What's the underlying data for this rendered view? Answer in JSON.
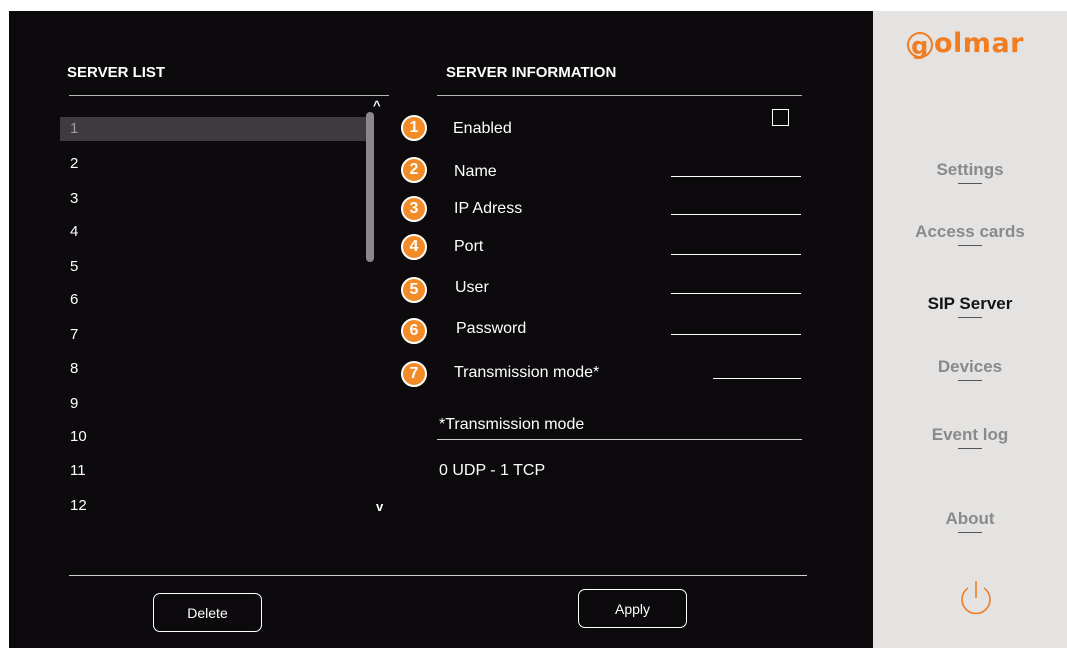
{
  "server_list": {
    "title": "SERVER LIST",
    "items": [
      "1",
      "2",
      "3",
      "4",
      "5",
      "6",
      "7",
      "8",
      "9",
      "10",
      "11",
      "12"
    ],
    "selected": "1",
    "scroll_up": "^",
    "scroll_down": "v"
  },
  "server_info": {
    "title": "SERVER INFORMATION",
    "fields": [
      {
        "num": "1",
        "label": "Enabled"
      },
      {
        "num": "2",
        "label": "Name"
      },
      {
        "num": "3",
        "label": "IP Adress"
      },
      {
        "num": "4",
        "label": "Port"
      },
      {
        "num": "5",
        "label": "User"
      },
      {
        "num": "6",
        "label": "Password"
      },
      {
        "num": "7",
        "label": "Transmission mode*"
      }
    ],
    "note_title": "*Transmission mode",
    "note_text": "0 UDP - 1 TCP"
  },
  "buttons": {
    "delete": "Delete",
    "apply": "Apply"
  },
  "sidebar": {
    "logo": "olmar",
    "logo_initial": "g",
    "items": [
      {
        "label": "Settings",
        "active": false
      },
      {
        "label": "Access cards",
        "active": false
      },
      {
        "label": "SIP Server",
        "active": true
      },
      {
        "label": "Devices",
        "active": false
      },
      {
        "label": "Event log",
        "active": false
      },
      {
        "label": "About",
        "active": false
      }
    ],
    "power_icon": "power-icon"
  },
  "colors": {
    "accent": "#f07d22",
    "badge": "#f28c28",
    "main_bg": "#0c0a0d",
    "sidebar_bg": "#e4e3e2"
  }
}
